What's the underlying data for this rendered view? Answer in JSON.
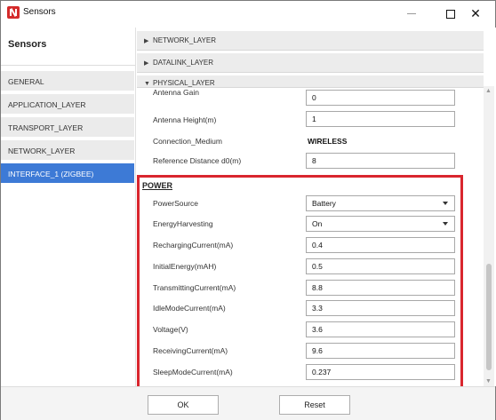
{
  "window": {
    "title": "Sensors"
  },
  "sidebar": {
    "title": "Sensors",
    "items": [
      {
        "label": "GENERAL"
      },
      {
        "label": "APPLICATION_LAYER"
      },
      {
        "label": "TRANSPORT_LAYER"
      },
      {
        "label": "NETWORK_LAYER"
      },
      {
        "label": "INTERFACE_1 (ZIGBEE)"
      }
    ]
  },
  "sections": {
    "network": "NETWORK_LAYER",
    "datalink": "DATALINK_LAYER",
    "physical": "PHYSICAL_LAYER"
  },
  "physical": {
    "antenna_gain": {
      "label": "Antenna Gain",
      "value": "0"
    },
    "antenna_height": {
      "label": "Antenna Height(m)",
      "value": "1"
    },
    "connection_medium": {
      "label": "Connection_Medium",
      "value": "WIRELESS"
    },
    "reference_distance": {
      "label": "Reference Distance d0(m)",
      "value": "8"
    }
  },
  "power": {
    "title": "POWER",
    "power_source": {
      "label": "PowerSource",
      "value": "Battery"
    },
    "energy_harvesting": {
      "label": "EnergyHarvesting",
      "value": "On"
    },
    "recharging_current": {
      "label": "RechargingCurrent(mA)",
      "value": "0.4"
    },
    "initial_energy": {
      "label": "InitialEnergy(mAH)",
      "value": "0.5"
    },
    "transmitting_current": {
      "label": "TransmittingCurrent(mA)",
      "value": "8.8"
    },
    "idle_mode_current": {
      "label": "IdleModeCurrent(mA)",
      "value": "3.3"
    },
    "voltage": {
      "label": "Voltage(V)",
      "value": "3.6"
    },
    "receiving_current": {
      "label": "ReceivingCurrent(mA)",
      "value": "9.6"
    },
    "sleep_mode_current": {
      "label": "SleepModeCurrent(mA)",
      "value": "0.237"
    }
  },
  "footer": {
    "ok_label": "OK",
    "reset_label": "Reset"
  },
  "colors": {
    "highlight": "#d9262e",
    "active_item": "#3d7ad6"
  }
}
